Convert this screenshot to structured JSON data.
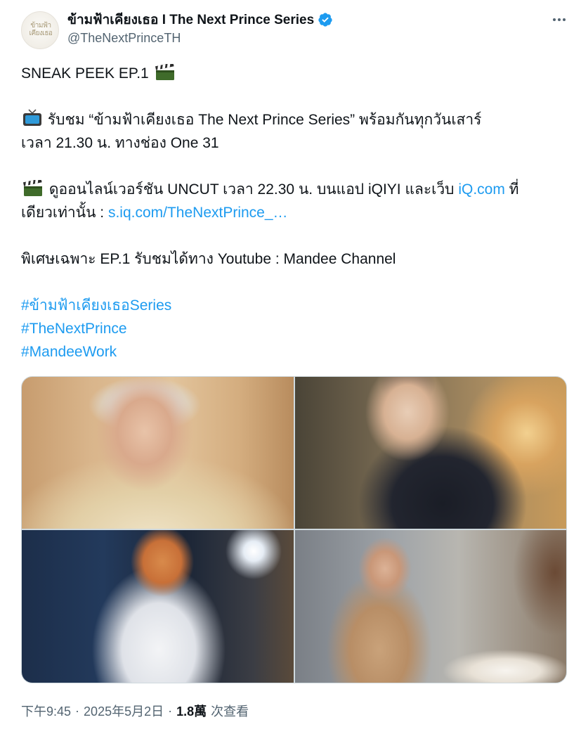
{
  "author": {
    "display_name": "ข้ามฟ้าเคียงเธอ I The Next Prince Series",
    "handle": "@TheNextPrinceTH",
    "avatar_text": "ข้ามฟ้า เคียงเธอ",
    "verified": true,
    "more_label": "More"
  },
  "tweet": {
    "line1": "SNEAK PEEK EP.1",
    "line1_emoji": "clapper-board-icon",
    "line2": "รับชม “ข้ามฟ้าเคียงเธอ The Next Prince Series” พร้อมกันทุกวันเสาร์",
    "line2_emoji": "television-icon",
    "line3": "เวลา 21.30 น. ทางช่อง One 31",
    "line4_pre": "ดูออนไลน์เวอร์ชัน UNCUT เวลา 22.30 น. บนแอป iQIYI และเว็บ",
    "line4_link": "iQ.com",
    "line4_post": "ที่",
    "line4_emoji": "clapper-board-icon",
    "line5_pre": "เดียวเท่านั้น :",
    "line5_link": "s.iq.com/TheNextPrince_…",
    "line6": "พิเศษเฉพาะ EP.1 รับชมได้ทาง Youtube : Mandee Channel",
    "hashtags": [
      "#ข้ามฟ้าเคียงเธอSeries",
      "#TheNextPrince",
      "#MandeeWork"
    ]
  },
  "footer": {
    "time": "下午9:45",
    "date": "2025年5月2日",
    "views_count": "1.8萬",
    "views_label": "次查看"
  },
  "colors": {
    "link": "#1d9bf0",
    "verified": "#1d9bf0",
    "secondary_text": "#536471"
  }
}
